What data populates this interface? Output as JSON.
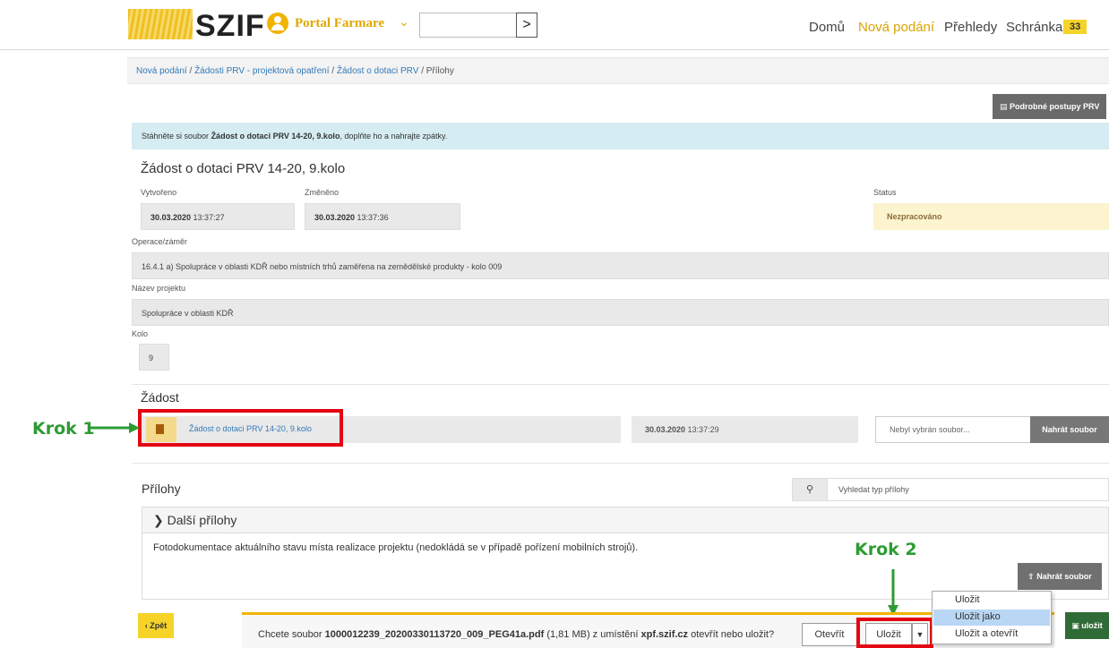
{
  "header": {
    "logo_text": "SZIF",
    "portal_name": "Portal Farmare",
    "portal_chevron": "⌄",
    "search_button": ">",
    "nav": [
      "Domů",
      "Nová podání",
      "Přehledy",
      "Schránka"
    ],
    "inbox_count": "33"
  },
  "breadcrumb": [
    "Nová podání",
    "Žádosti PRV - projektová opatření",
    "Žádost o dotaci PRV",
    "Přílohy"
  ],
  "breadcrumb_sep": "/",
  "guide_button": "Podrobné postupy PRV",
  "info": {
    "prefix": "Stáhněte si soubor ",
    "bold": "Žádost o dotaci PRV 14-20, 9.kolo",
    "suffix": ", doplňte ho a nahrajte zpátky."
  },
  "form": {
    "title": "Žádost o dotaci PRV 14-20, 9.kolo",
    "created_label": "Vytvořeno",
    "created_date": "30.03.2020",
    "created_time": " 13:37:27",
    "changed_label": "Změněno",
    "changed_date": "30.03.2020",
    "changed_time": " 13:37:36",
    "status_label": "Status",
    "status_value": "Nezpracováno",
    "operation_label": "Operace/záměr",
    "operation_value": "16.4.1 a) Spolupráce v oblasti KDŘ nebo místních trhů zaměřena na zemědělské produkty - kolo 009",
    "project_label": "Název projektu",
    "project_value": "Spolupráce v oblasti KDŘ",
    "round_label": "Kolo",
    "round_value": "9"
  },
  "request": {
    "section_title": "Žádost",
    "file_link": "Žádost o dotaci PRV 14-20, 9.kolo",
    "file_date": "30.03.2020",
    "file_time": " 13:37:29",
    "file_input_placeholder": "Nebyl vybrán soubor...",
    "upload_button": "Nahrát soubor"
  },
  "attachments": {
    "section_title": "Přílohy",
    "search_placeholder": "Vyhledat typ přílohy",
    "panel_title": "Další přílohy",
    "panel_text": "Fotodokumentace aktuálního stavu místa realizace projektu (nedokládá se v případě pořízení mobilních strojů).",
    "upload_button": "Nahrát soubor"
  },
  "footer": {
    "back_button": "Zpět",
    "save_button": "uložit"
  },
  "download_bar": {
    "prefix": "Chcete soubor ",
    "filename": "1000012239_20200330113720_009_PEG41a.pdf",
    "size": " (1,81 MB) z umístění ",
    "domain": "xpf.szif.cz",
    "suffix": " otevřít nebo uložit?",
    "open_button": "Otevřít",
    "save_button": "Uložit"
  },
  "save_menu": [
    "Uložit",
    "Uložit jako",
    "Uložit a otevřít"
  ],
  "annotations": {
    "step1": "Krok 1",
    "step2": "Krok 2"
  },
  "colors": {
    "accent_yellow": "#f5d328",
    "annotation_green": "#2d9b34",
    "annotation_red": "#e30613",
    "info_bg": "#d5ecf3"
  }
}
